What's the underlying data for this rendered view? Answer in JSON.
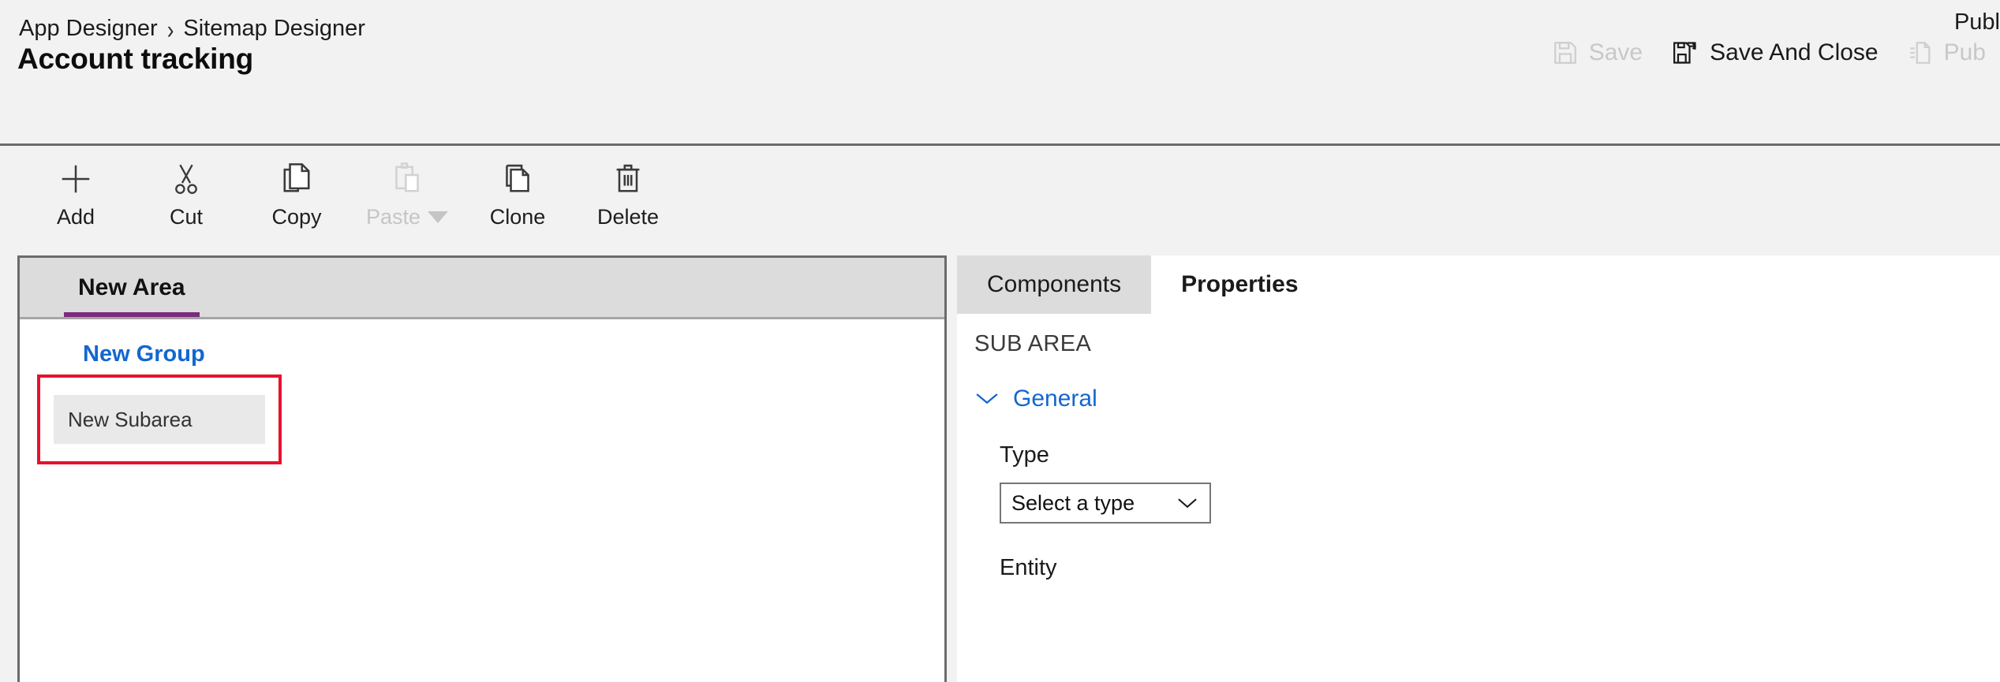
{
  "header": {
    "breadcrumb": {
      "parent": "App Designer",
      "separator": "›",
      "current": "Sitemap Designer"
    },
    "title": "Account tracking",
    "publish_status": "Publ",
    "actions": {
      "save": "Save",
      "save_and_close": "Save And Close",
      "publish": "Pub"
    }
  },
  "commandbar": {
    "buttons": [
      {
        "label": "Add",
        "icon": "plus-icon",
        "enabled": true
      },
      {
        "label": "Cut",
        "icon": "scissors-icon",
        "enabled": true
      },
      {
        "label": "Copy",
        "icon": "copy-pages-icon",
        "enabled": true
      },
      {
        "label": "Paste",
        "icon": "clipboard-icon",
        "enabled": false,
        "has_menu": true
      },
      {
        "label": "Clone",
        "icon": "clone-pages-icon",
        "enabled": true
      },
      {
        "label": "Delete",
        "icon": "trash-icon",
        "enabled": true
      }
    ]
  },
  "canvas": {
    "area_tab": "New Area",
    "group_title": "New Group",
    "subarea_label": "New Subarea"
  },
  "panel": {
    "tabs": [
      {
        "label": "Components",
        "active": false
      },
      {
        "label": "Properties",
        "active": true
      }
    ],
    "heading": "SUB AREA",
    "section": "General",
    "fields": {
      "type_label": "Type",
      "type_value": "Select a type",
      "entity_label": "Entity"
    }
  },
  "colors": {
    "accent_purple": "#7a2c7d",
    "link_blue": "#1367cf",
    "selection_red": "#e8112d",
    "page_bg": "#f2f2f2",
    "tab_gray": "#dcdcdc"
  }
}
